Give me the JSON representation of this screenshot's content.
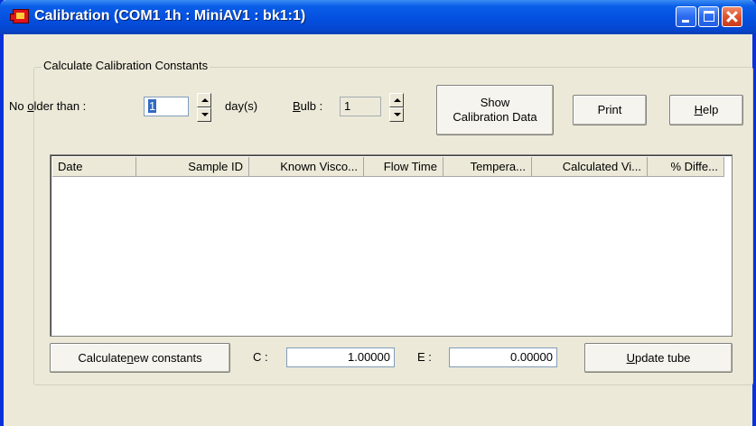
{
  "window": {
    "title": "Calibration (COM1 1h : MiniAV1 : bk1:1)"
  },
  "group": {
    "legend": "Calculate Calibration Constants"
  },
  "filters": {
    "no_older_than_label_pre": "No ",
    "no_older_than_label_u": "o",
    "no_older_than_label_post": "lder than :",
    "days_value": "1",
    "days_unit": "day(s)",
    "bulb_label_u": "B",
    "bulb_label_post": "ulb :",
    "bulb_value": "1"
  },
  "buttons": {
    "show_calibration_line1": "Show",
    "show_calibration_line2": "Calibration Data",
    "print": "Print",
    "help_u": "H",
    "help_post": "elp",
    "calc_pre": "Calculate ",
    "calc_u": "n",
    "calc_post": "ew constants",
    "update_u": "U",
    "update_post": "pdate tube"
  },
  "table": {
    "columns": [
      "Date",
      "Sample ID",
      "Known Visco...",
      "Flow Time",
      "Tempera...",
      "Calculated Vi...",
      "% Diffe..."
    ],
    "rows": []
  },
  "constants": {
    "c_label": "C :",
    "c_value": "1.00000",
    "e_label": "E :",
    "e_value": "0.00000"
  }
}
